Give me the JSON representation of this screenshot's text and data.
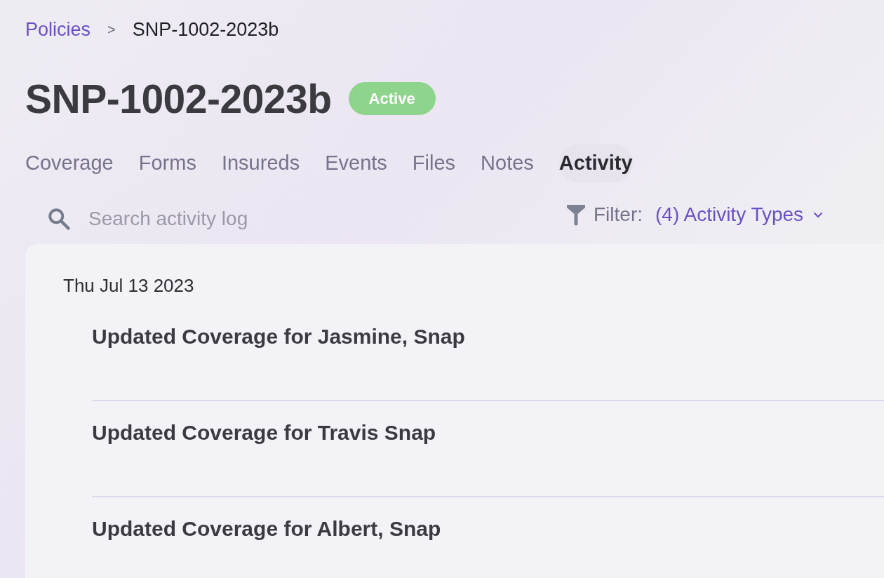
{
  "breadcrumb": [
    {
      "label": "Policies",
      "link": true
    },
    {
      "label": "SNP-1002-2023b",
      "link": false
    }
  ],
  "breadcrumb_separator": ">",
  "title": "SNP-1002-2023b",
  "status": {
    "label": "Active",
    "kind": "active"
  },
  "tabs": [
    {
      "label": "Coverage",
      "selected": false
    },
    {
      "label": "Forms",
      "selected": false
    },
    {
      "label": "Insureds",
      "selected": false
    },
    {
      "label": "Events",
      "selected": false
    },
    {
      "label": "Files",
      "selected": false
    },
    {
      "label": "Notes",
      "selected": false
    },
    {
      "label": "Activity",
      "selected": true
    }
  ],
  "search": {
    "placeholder": "Search activity log"
  },
  "filter": {
    "label": "Filter:",
    "value": "(4) Activity Types"
  },
  "days": [
    {
      "date": "Thu Jul 13 2023",
      "entries": [
        {
          "title": "Updated Coverage for Jasmine, Snap"
        },
        {
          "title": "Updated Coverage for Travis Snap"
        },
        {
          "title": "Updated Coverage for Albert, Snap"
        }
      ]
    }
  ]
}
